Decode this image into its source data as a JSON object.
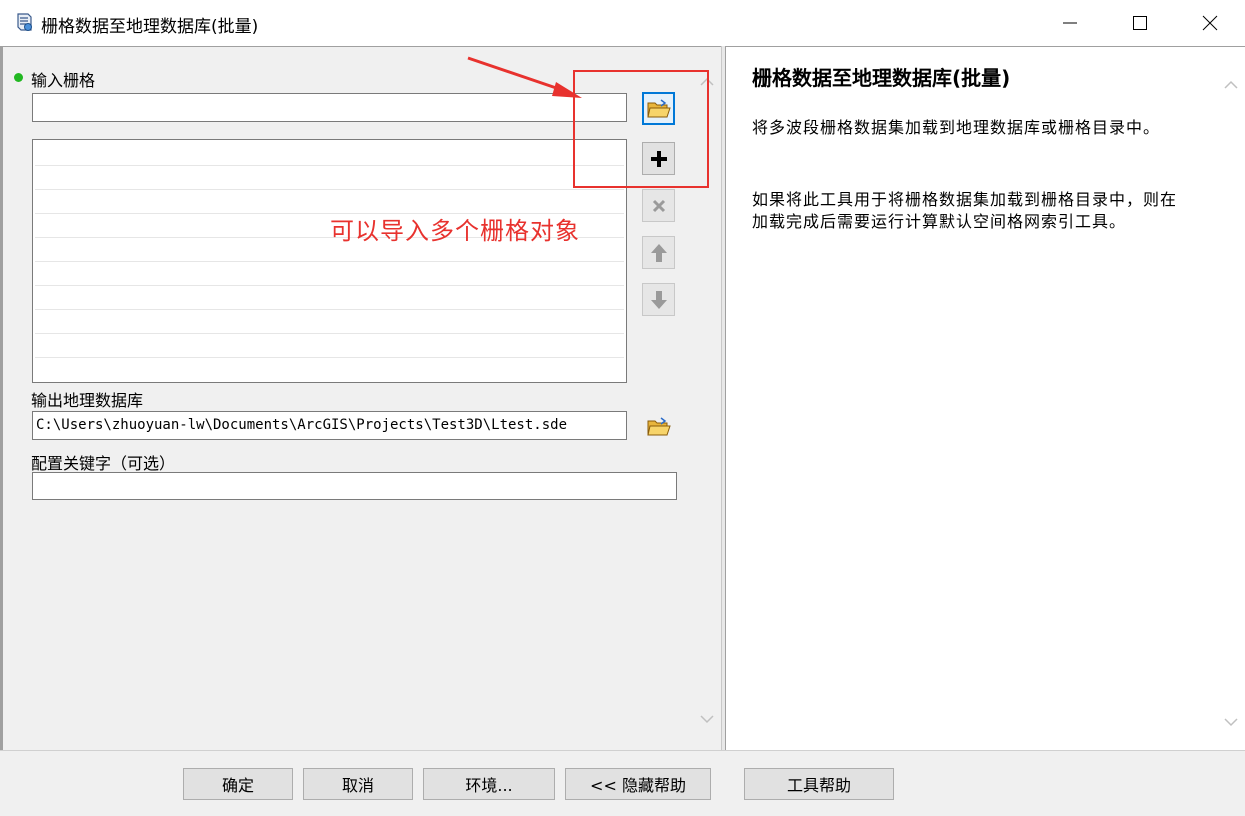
{
  "window": {
    "title": "栅格数据至地理数据库(批量)",
    "controls": {
      "minimize": "—",
      "maximize": "☐",
      "close": "✕"
    }
  },
  "form": {
    "input_raster": {
      "label": "输入栅格",
      "value": "",
      "required_indicator_color": "#22b822"
    },
    "list_rows": [
      "",
      "",
      "",
      "",
      "",
      "",
      "",
      "",
      "",
      ""
    ],
    "output_gdb": {
      "label": "输出地理数据库",
      "value": "C:\\Users\\zhuoyuan-lw\\Documents\\ArcGIS\\Projects\\Test3D\\Ltest.sde"
    },
    "config_keyword": {
      "label": "配置关键字（可选）",
      "value": ""
    }
  },
  "side_buttons": {
    "browse": "folder-open-icon",
    "add": "plus-icon",
    "remove": "x-icon",
    "move_up": "arrow-up-icon",
    "move_down": "arrow-down-icon"
  },
  "annotation": {
    "text": "可以导入多个栅格对象",
    "color": "#e8322e"
  },
  "help": {
    "title": "栅格数据至地理数据库(批量)",
    "paragraphs": [
      "将多波段栅格数据集加载到地理数据库或栅格目录中。",
      "如果将此工具用于将栅格数据集加载到栅格目录中，则在加载完成后需要运行计算默认空间格网索引工具。"
    ]
  },
  "buttons": {
    "ok": "确定",
    "cancel": "取消",
    "environments": "环境...",
    "hide_help": "<< 隐藏帮助",
    "tool_help": "工具帮助"
  }
}
